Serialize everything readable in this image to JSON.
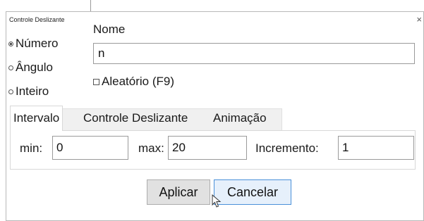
{
  "dialog": {
    "title": "Controle Deslizante",
    "close_symbol": "×"
  },
  "type_options": [
    {
      "label": "Número",
      "selected": true
    },
    {
      "label": "Ângulo",
      "selected": false
    },
    {
      "label": "Inteiro",
      "selected": false
    }
  ],
  "name": {
    "label": "Nome",
    "value": "n"
  },
  "random": {
    "label": "Aleatório (F9)",
    "checked": false
  },
  "tabs": [
    {
      "label": "Intervalo",
      "active": true
    },
    {
      "label": "Controle Deslizante",
      "active": false
    },
    {
      "label": "Animação",
      "active": false
    }
  ],
  "interval": {
    "min_label": "min:",
    "min_value": "0",
    "max_label": "max:",
    "max_value": "20",
    "increment_label": "Incremento:",
    "increment_value": "1"
  },
  "buttons": {
    "apply": "Aplicar",
    "cancel": "Cancelar"
  },
  "colors": {
    "focus_border": "#4a90d9"
  },
  "icons": {
    "close": "close-icon",
    "cursor": "mouse-pointer-icon"
  }
}
